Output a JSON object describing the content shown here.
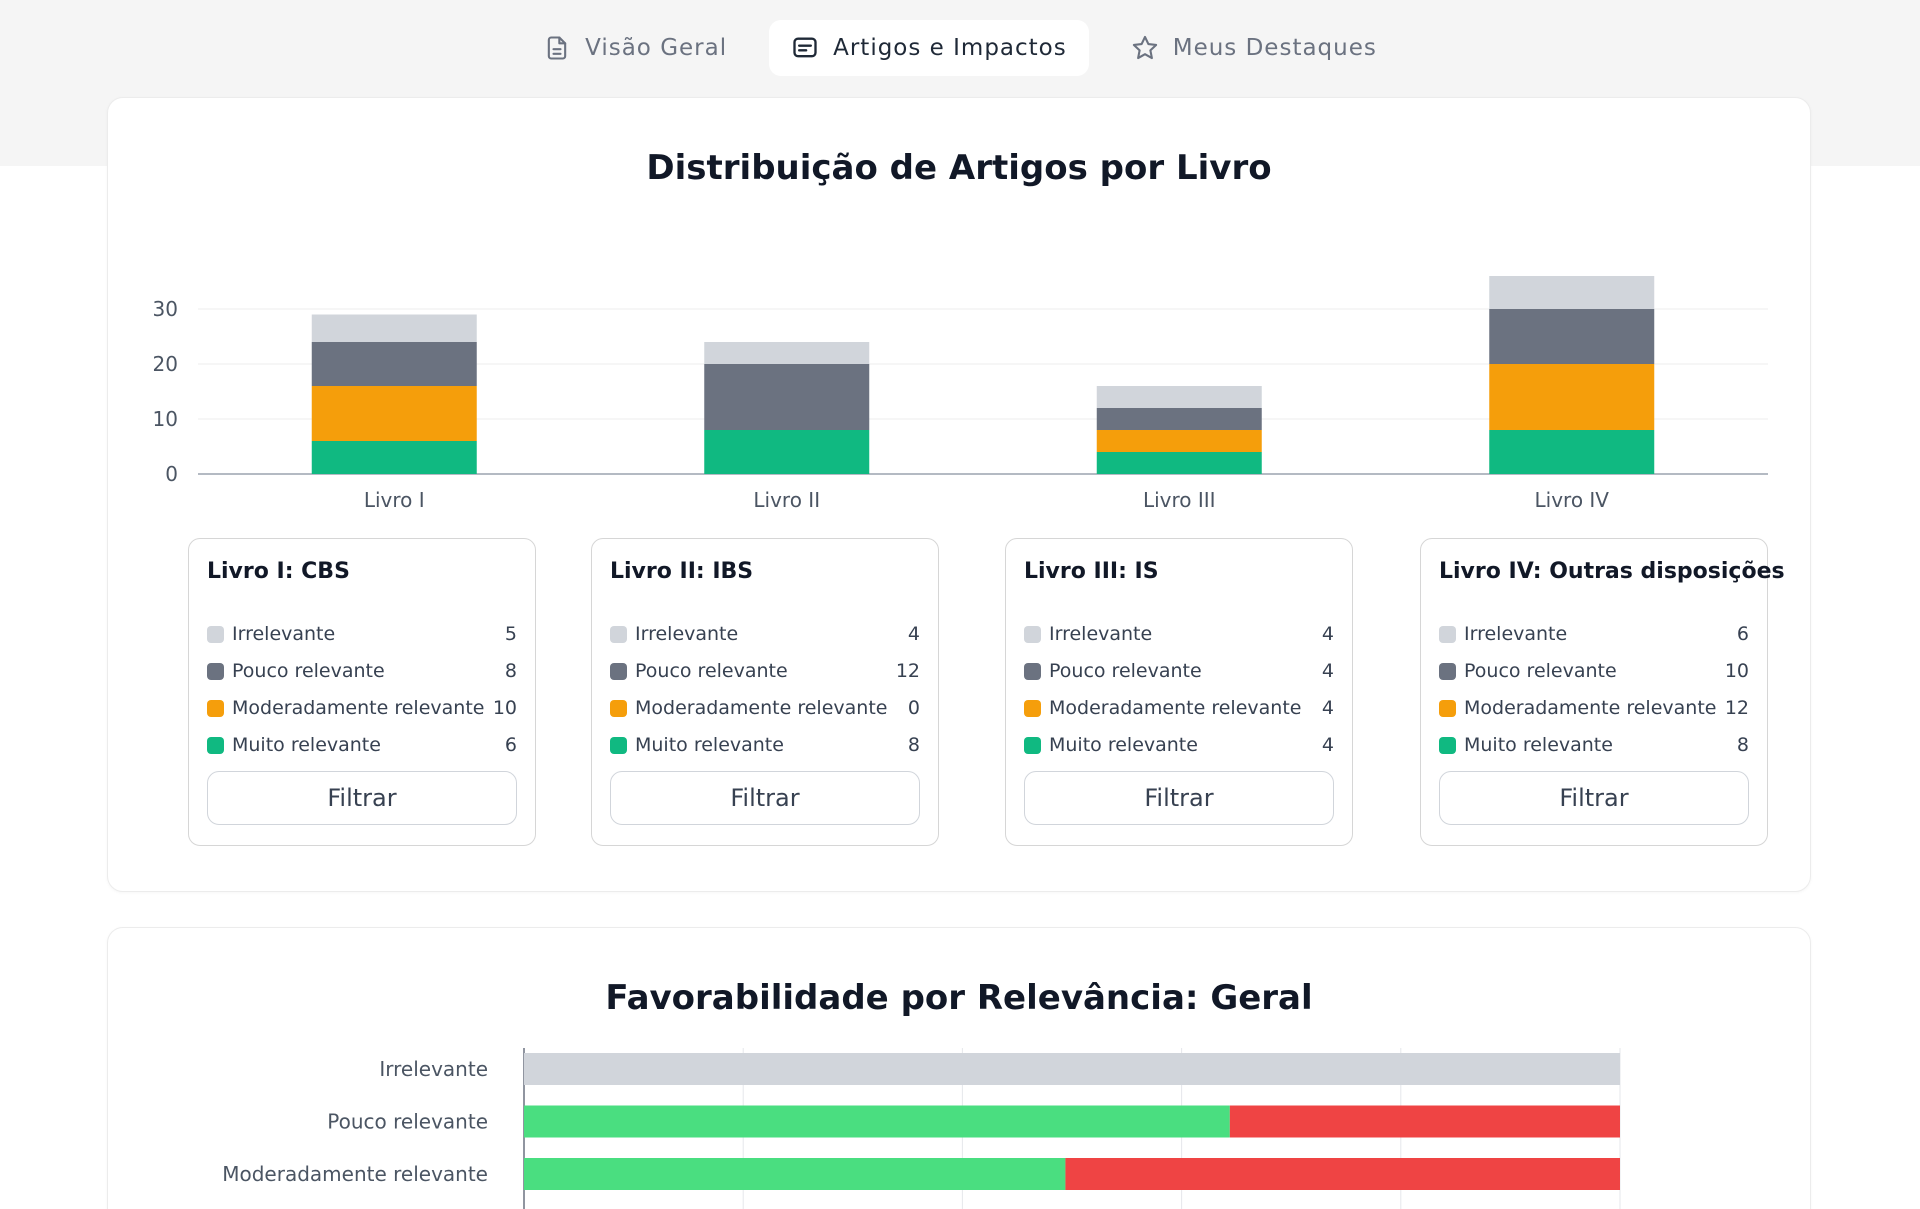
{
  "tabs": [
    {
      "label": "Visão Geral",
      "icon": "document-icon",
      "active": false
    },
    {
      "label": "Artigos e Impactos",
      "icon": "message-square-icon",
      "active": true
    },
    {
      "label": "Meus Destaques",
      "icon": "star-icon",
      "active": false
    }
  ],
  "colors": {
    "irrelevante": "#d1d5db",
    "pouco": "#6b7280",
    "moderado": "#f59e0b",
    "muito": "#10b981",
    "favoravel": "#4ade80",
    "desfavoravel": "#ef4444"
  },
  "distribution": {
    "title": "Distribuição de Artigos por Livro",
    "chart_data": {
      "type": "bar",
      "stacked": true,
      "categories": [
        "Livro I",
        "Livro II",
        "Livro III",
        "Livro IV"
      ],
      "series": [
        {
          "name": "Muito relevante",
          "values": [
            6,
            8,
            4,
            8
          ]
        },
        {
          "name": "Moderadamente relevante",
          "values": [
            10,
            0,
            4,
            12
          ]
        },
        {
          "name": "Pouco relevante",
          "values": [
            8,
            12,
            4,
            10
          ]
        },
        {
          "name": "Irrelevante",
          "values": [
            5,
            4,
            4,
            6
          ]
        }
      ],
      "yticks": [
        0,
        10,
        20,
        30
      ],
      "ylim": [
        0,
        36
      ],
      "grid": true
    },
    "books": [
      {
        "title": "Livro I: CBS",
        "items": [
          {
            "label": "Irrelevante",
            "count": "5"
          },
          {
            "label": "Pouco relevante",
            "count": "8"
          },
          {
            "label": "Moderadamente relevante",
            "count": "10"
          },
          {
            "label": "Muito relevante",
            "count": "6"
          }
        ],
        "button": "Filtrar"
      },
      {
        "title": "Livro II: IBS",
        "items": [
          {
            "label": "Irrelevante",
            "count": "4"
          },
          {
            "label": "Pouco relevante",
            "count": "12"
          },
          {
            "label": "Moderadamente relevante",
            "count": "0"
          },
          {
            "label": "Muito relevante",
            "count": "8"
          }
        ],
        "button": "Filtrar"
      },
      {
        "title": "Livro III: IS",
        "items": [
          {
            "label": "Irrelevante",
            "count": "4"
          },
          {
            "label": "Pouco relevante",
            "count": "4"
          },
          {
            "label": "Moderadamente relevante",
            "count": "4"
          },
          {
            "label": "Muito relevante",
            "count": "4"
          }
        ],
        "button": "Filtrar"
      },
      {
        "title": "Livro IV: Outras disposições",
        "items": [
          {
            "label": "Irrelevante",
            "count": "6"
          },
          {
            "label": "Pouco relevante",
            "count": "10"
          },
          {
            "label": "Moderadamente relevante",
            "count": "12"
          },
          {
            "label": "Muito relevante",
            "count": "8"
          }
        ],
        "button": "Filtrar"
      }
    ]
  },
  "favorability": {
    "title": "Favorabilidade por Relevância: Geral",
    "chart_data": {
      "type": "bar",
      "orientation": "horizontal",
      "stacked": true,
      "normalized": true,
      "categories": [
        "Irrelevante",
        "Pouco relevante",
        "Moderadamente relevante"
      ],
      "series": [
        {
          "values": [
            0,
            0.644,
            0.494
          ]
        },
        {
          "values": [
            0,
            0.356,
            0.506
          ]
        },
        {
          "values": [
            1,
            0,
            0
          ]
        }
      ],
      "grid": true
    }
  }
}
